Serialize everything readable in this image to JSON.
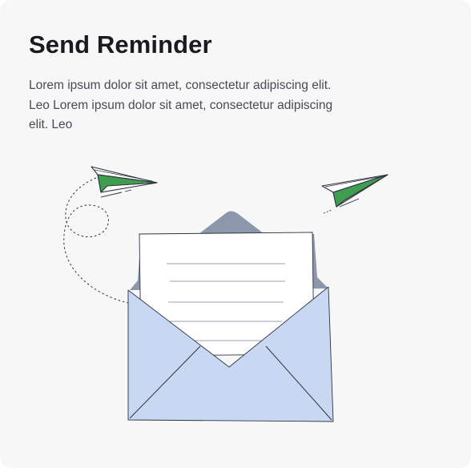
{
  "card": {
    "title": "Send Reminder",
    "description": "Lorem ipsum dolor sit amet, consectetur adipiscing elit. Leo Lorem ipsum dolor sit amet, consectetur adipiscing elit. Leo"
  },
  "illustration": {
    "subject": "open envelope with letter and two paper planes",
    "icons": [
      "envelope-icon",
      "letter-icon",
      "paper-plane-icon"
    ]
  },
  "colors": {
    "background": "#f7f7f8",
    "title": "#1b1b1f",
    "text": "#4a4a52",
    "envelope": "#c8d8f3",
    "envelope_back": "#8c97ab",
    "plane_accent": "#3f9d4f",
    "line": "#2e3340"
  }
}
